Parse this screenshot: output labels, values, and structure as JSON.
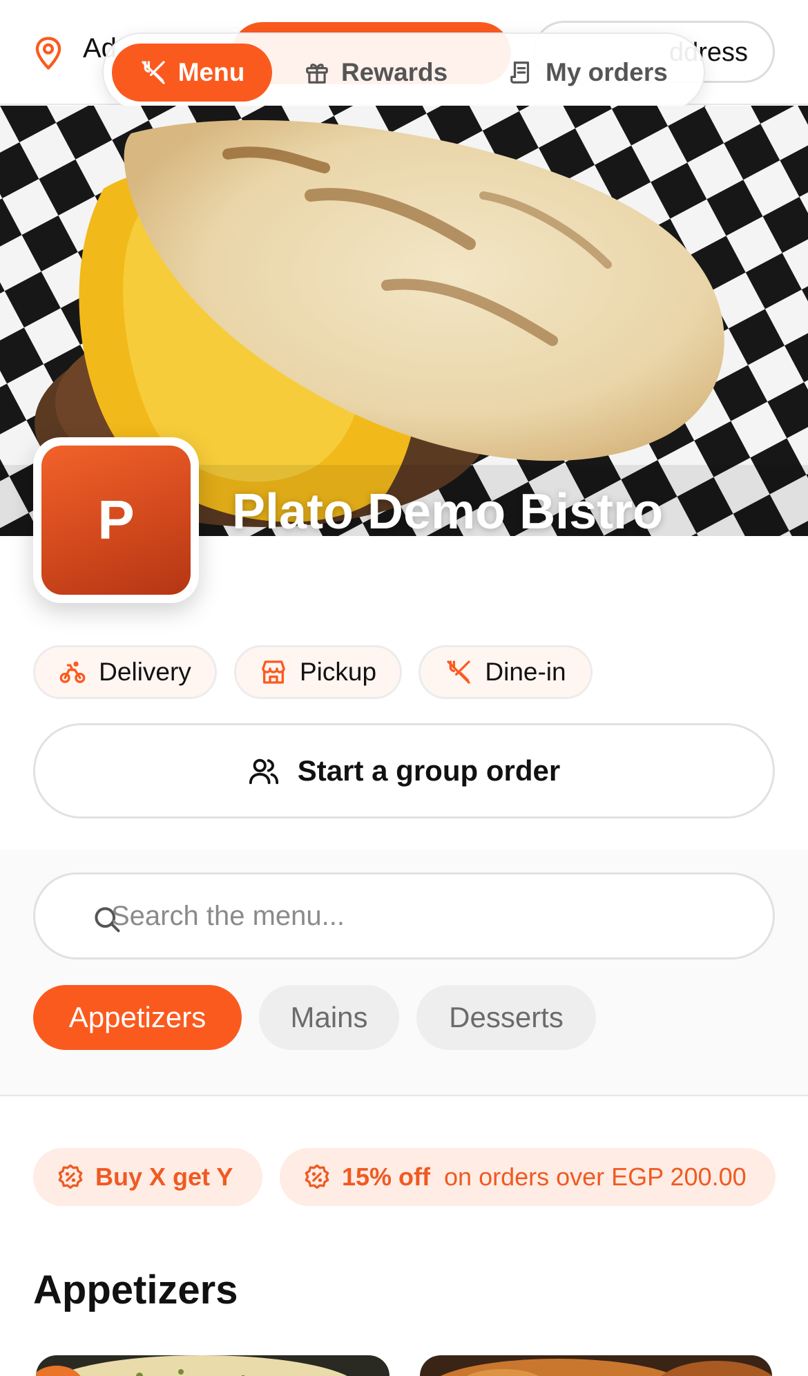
{
  "topbar": {
    "location_text": "Ad",
    "address_text": "ddress"
  },
  "nav": {
    "items": [
      {
        "label": "Menu",
        "icon": "utensils-crossed-icon",
        "active": true
      },
      {
        "label": "Rewards",
        "icon": "gift-icon",
        "active": false
      },
      {
        "label": "My orders",
        "icon": "receipt-icon",
        "active": false
      }
    ]
  },
  "restaurant": {
    "logo_letter": "P",
    "name": "Plato Demo Bistro"
  },
  "order_modes": [
    {
      "label": "Delivery",
      "icon": "bike-icon"
    },
    {
      "label": "Pickup",
      "icon": "store-icon"
    },
    {
      "label": "Dine-in",
      "icon": "utensils-crossed-icon"
    }
  ],
  "group_order": {
    "label": "Start a group order",
    "icon": "users-icon"
  },
  "search": {
    "placeholder": "Search the menu..."
  },
  "categories": [
    {
      "label": "Appetizers",
      "active": true
    },
    {
      "label": "Mains",
      "active": false
    },
    {
      "label": "Desserts",
      "active": false
    }
  ],
  "promotions": [
    {
      "title": "Buy X get Y",
      "detail": "",
      "icon": "badge-percent-icon"
    },
    {
      "title": "15% off",
      "detail": "on orders over EGP 200.00",
      "icon": "badge-percent-icon"
    }
  ],
  "section": {
    "title": "Appetizers"
  },
  "colors": {
    "accent": "#fb5a1f",
    "accent_light": "#ffece4",
    "text": "#111111",
    "muted": "#6b6b6b"
  }
}
